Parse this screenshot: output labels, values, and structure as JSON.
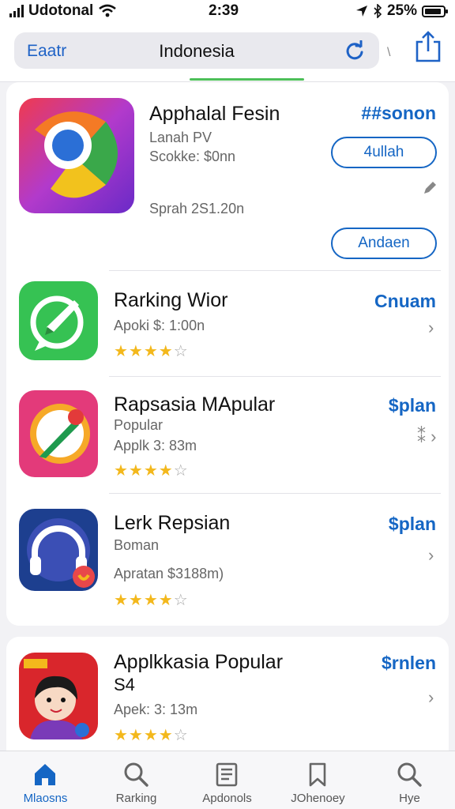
{
  "status_bar": {
    "carrier": "Udotonal",
    "time": "2:39",
    "battery": "25%"
  },
  "nav": {
    "left_label": "Eaatr",
    "title": "Indonesia"
  },
  "featured": {
    "title": "Apphalal Fesin",
    "line1": "Lanah PV",
    "line2": "Scokke: $0nn",
    "line3": "Sprah 2S1.20n",
    "price": "##sonon",
    "button1": "4ullah",
    "button2": "Andaen",
    "stars": 0
  },
  "apps": [
    {
      "title": "Rarking Wior",
      "sub1": "Apoki $: 1:00n",
      "price": "Cnuam",
      "rating": 4,
      "chevron": "›"
    },
    {
      "title": "Rapsasia MApular",
      "sub0": "Popular",
      "sub1": "Applk 3: 83m",
      "price": "$plan",
      "rating": 4,
      "chevron": "›"
    },
    {
      "title": "Lerk Repsian",
      "sub0": "Boman",
      "sub1": "Apratan $3188m)",
      "price": "$plan",
      "rating": 4,
      "chevron": "›"
    }
  ],
  "bottom_app": {
    "title": "Applkkasia Popular",
    "title2": "S4",
    "sub1": "Apek: 3: 13m",
    "price": "$rnlen",
    "rating": 4,
    "chevron": "›"
  },
  "tabs": [
    {
      "label": "Mlaosns",
      "icon": "home-icon",
      "active": true
    },
    {
      "label": "Rarking",
      "icon": "search-icon",
      "active": false
    },
    {
      "label": "Apdonols",
      "icon": "document-icon",
      "active": false
    },
    {
      "label": "JOhenoey",
      "icon": "bookmark-icon",
      "active": false
    },
    {
      "label": "Hye",
      "icon": "search-icon",
      "active": false
    }
  ],
  "colors": {
    "accent": "#1566c4",
    "star": "#f3b81c",
    "progress": "#4cbf58"
  }
}
